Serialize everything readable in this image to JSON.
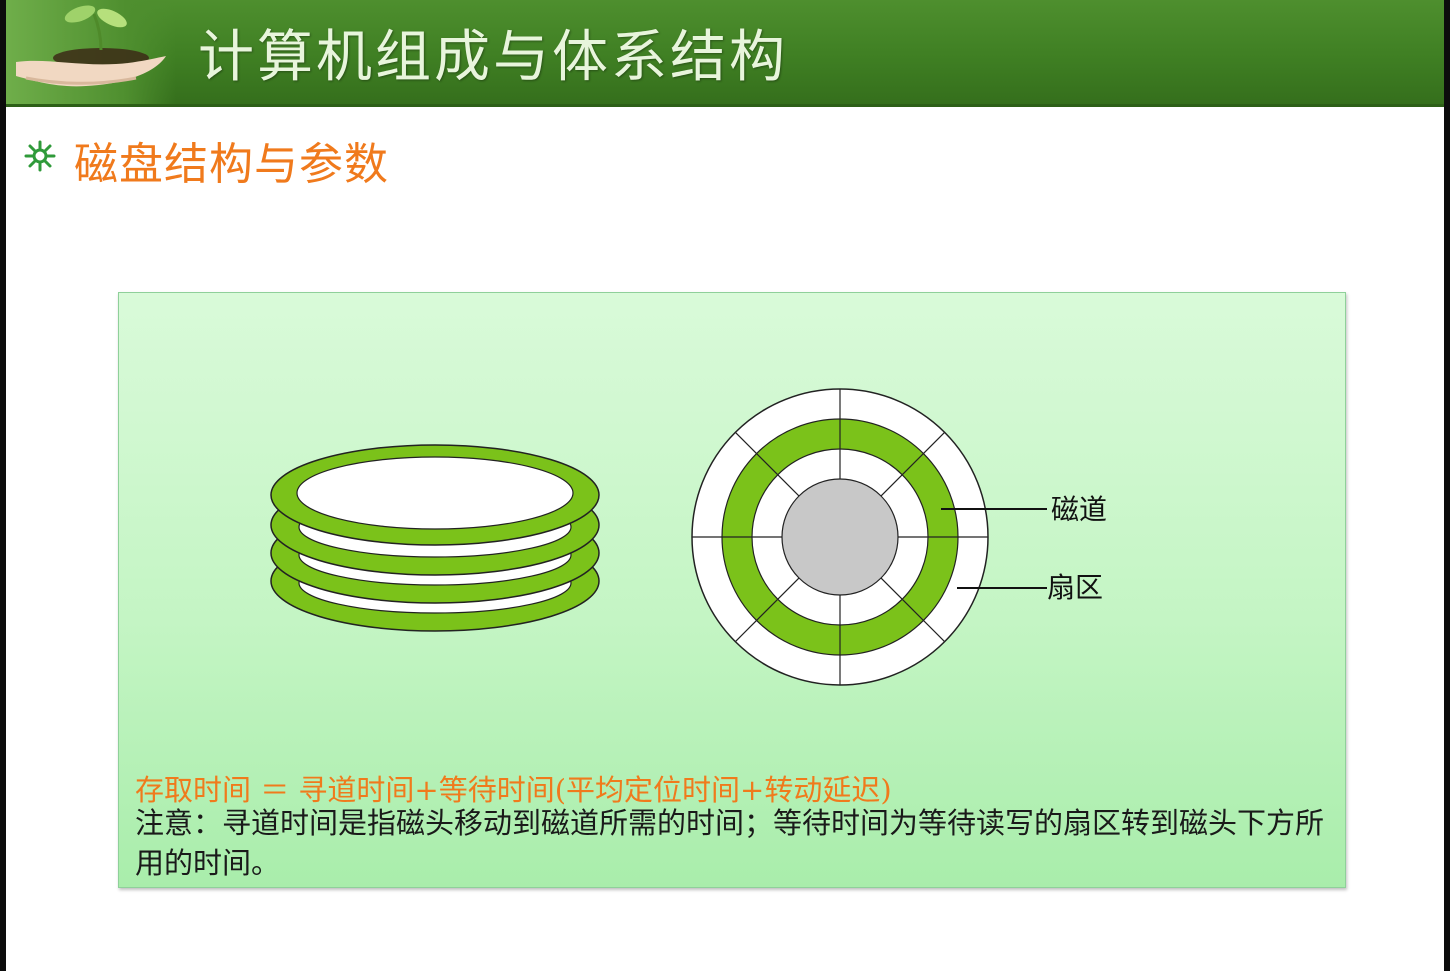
{
  "header": {
    "title": "计算机组成与体系结构"
  },
  "section": {
    "title": "磁盘结构与参数"
  },
  "diagram": {
    "labels": {
      "track": "磁道",
      "sector": "扇区"
    }
  },
  "content": {
    "formula": "存取时间 ＝ 寻道时间+等待时间(平均定位时间+转动延迟)",
    "note": "注意：寻道时间是指磁头移动到磁道所需的时间；等待时间为等待读写的扇区转到磁头下方所用的时间。"
  },
  "colors": {
    "header_green": "#3f7f23",
    "title_orange": "#f07a1c",
    "disk_green": "#7bc21a",
    "hub_gray": "#c8c8c8",
    "panel_green": "#c4f5c4"
  }
}
